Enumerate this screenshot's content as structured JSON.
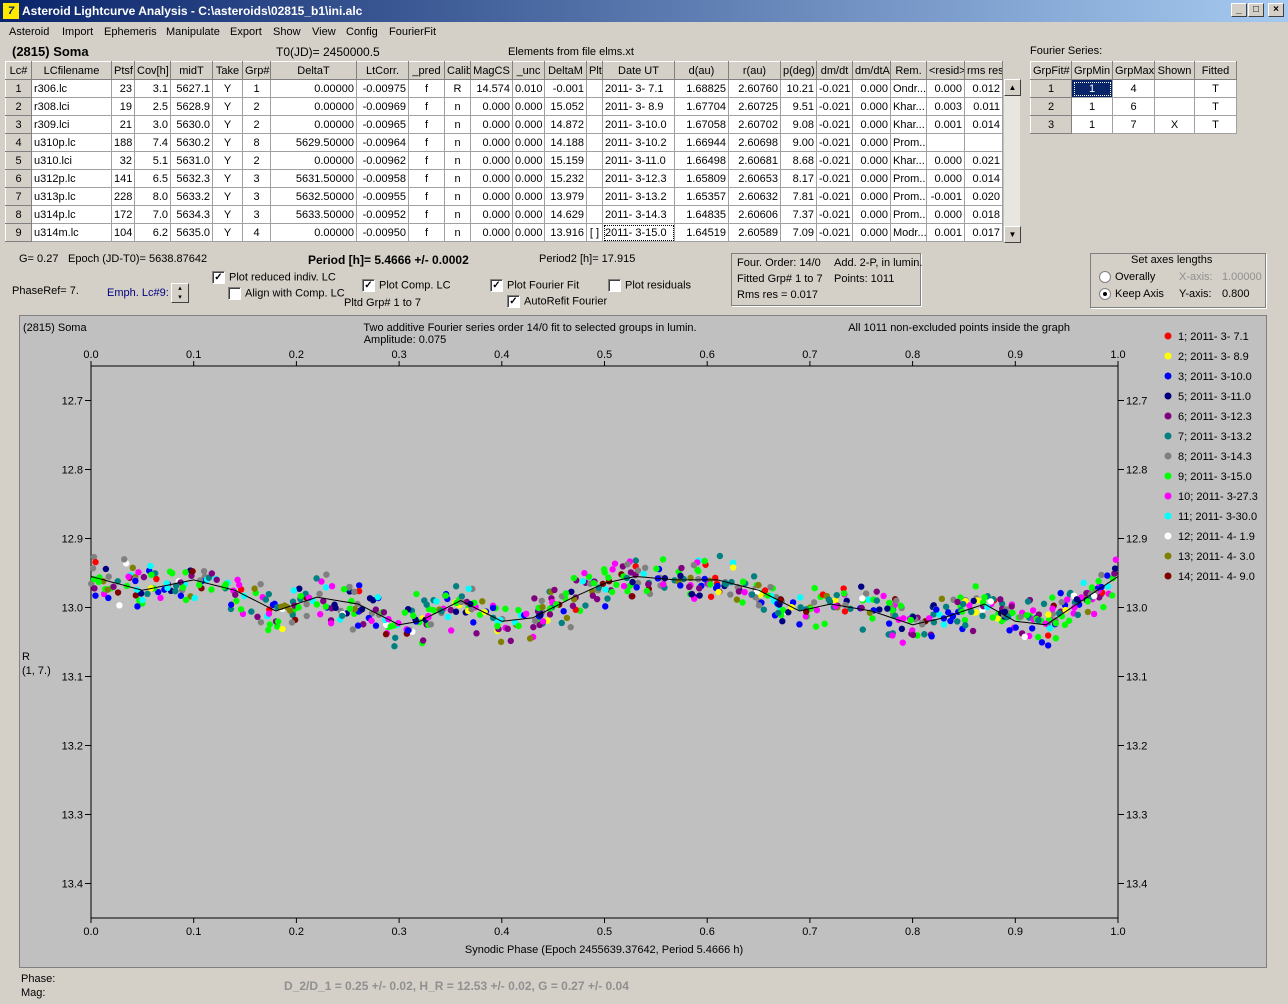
{
  "window": {
    "title": "Asteroid Lightcurve Analysis - C:\\asteroids\\02815_b1\\ini.alc",
    "icon": "app-icon",
    "min": "_",
    "max": "□",
    "close": "×"
  },
  "menu": [
    "Asteroid",
    "Import",
    "Ephemeris",
    "Manipulate",
    "Export",
    "Show",
    "View",
    "Config",
    "FourierFit"
  ],
  "asteroid_name": "(2815) Soma",
  "t0": "T0(JD)= 2450000.5",
  "elements_note": "Elements from file elms.xt",
  "lc_table": {
    "headers": [
      "Lc#",
      "LCfilename",
      "Ptsf",
      "Cov[h]",
      "midT",
      "Take",
      "Grp#",
      "DeltaT",
      "LtCorr.",
      "_pred",
      "Calib",
      "MagCS",
      "_unc",
      "DeltaM",
      "Plt",
      "Date UT",
      "d(au)",
      "r(au)",
      "p(deg)",
      "dm/dt",
      "dm/dtA",
      "Rem.",
      "<resid>",
      "rms res"
    ],
    "rows": [
      [
        "1",
        "r306.lc",
        "23",
        "3.1",
        "5627.1",
        "Y",
        "1",
        "0.00000",
        "-0.00975",
        "f",
        "R",
        "14.574",
        "0.010",
        "-0.001",
        "",
        "2011- 3- 7.1",
        "1.68825",
        "2.60760",
        "10.21",
        "-0.021",
        "0.000",
        "Ondr...",
        "0.000",
        "0.012"
      ],
      [
        "2",
        "r308.lci",
        "19",
        "2.5",
        "5628.9",
        "Y",
        "2",
        "0.00000",
        "-0.00969",
        "f",
        "n",
        "0.000",
        "0.000",
        "15.052",
        "",
        "2011- 3- 8.9",
        "1.67704",
        "2.60725",
        "9.51",
        "-0.021",
        "0.000",
        "Khar...",
        "0.003",
        "0.011"
      ],
      [
        "3",
        "r309.lci",
        "21",
        "3.0",
        "5630.0",
        "Y",
        "2",
        "0.00000",
        "-0.00965",
        "f",
        "n",
        "0.000",
        "0.000",
        "14.872",
        "",
        "2011- 3-10.0",
        "1.67058",
        "2.60702",
        "9.08",
        "-0.021",
        "0.000",
        "Khar...",
        "0.001",
        "0.014"
      ],
      [
        "4",
        "u310p.lc",
        "188",
        "7.4",
        "5630.2",
        "Y",
        "8",
        "5629.50000",
        "-0.00964",
        "f",
        "n",
        "0.000",
        "0.000",
        "14.188",
        "",
        "2011- 3-10.2",
        "1.66944",
        "2.60698",
        "9.00",
        "-0.021",
        "0.000",
        "Prom...",
        "",
        ""
      ],
      [
        "5",
        "u310.lci",
        "32",
        "5.1",
        "5631.0",
        "Y",
        "2",
        "0.00000",
        "-0.00962",
        "f",
        "n",
        "0.000",
        "0.000",
        "15.159",
        "",
        "2011- 3-11.0",
        "1.66498",
        "2.60681",
        "8.68",
        "-0.021",
        "0.000",
        "Khar...",
        "0.000",
        "0.021"
      ],
      [
        "6",
        "u312p.lc",
        "141",
        "6.5",
        "5632.3",
        "Y",
        "3",
        "5631.50000",
        "-0.00958",
        "f",
        "n",
        "0.000",
        "0.000",
        "15.232",
        "",
        "2011- 3-12.3",
        "1.65809",
        "2.60653",
        "8.17",
        "-0.021",
        "0.000",
        "Prom...",
        "0.000",
        "0.014"
      ],
      [
        "7",
        "u313p.lc",
        "228",
        "8.0",
        "5633.2",
        "Y",
        "3",
        "5632.50000",
        "-0.00955",
        "f",
        "n",
        "0.000",
        "0.000",
        "13.979",
        "",
        "2011- 3-13.2",
        "1.65357",
        "2.60632",
        "7.81",
        "-0.021",
        "0.000",
        "Prom...",
        "-0.001",
        "0.020"
      ],
      [
        "8",
        "u314p.lc",
        "172",
        "7.0",
        "5634.3",
        "Y",
        "3",
        "5633.50000",
        "-0.00952",
        "f",
        "n",
        "0.000",
        "0.000",
        "14.629",
        "",
        "2011- 3-14.3",
        "1.64835",
        "2.60606",
        "7.37",
        "-0.021",
        "0.000",
        "Prom...",
        "0.000",
        "0.018"
      ],
      [
        "9",
        "u314m.lc",
        "104",
        "6.2",
        "5635.0",
        "Y",
        "4",
        "0.00000",
        "-0.00950",
        "f",
        "n",
        "0.000",
        "0.000",
        "13.916",
        "[ ]",
        "2011- 3-15.0",
        "1.64519",
        "2.60589",
        "7.09",
        "-0.021",
        "0.000",
        "Modr...",
        "0.001",
        "0.017"
      ]
    ]
  },
  "fourier": {
    "label": "Fourier Series:",
    "headers": [
      "GrpFit#",
      "GrpMin",
      "GrpMax",
      "Shown",
      "Fitted"
    ],
    "rows": [
      [
        "1",
        "1",
        "4",
        "",
        "T"
      ],
      [
        "2",
        "1",
        "6",
        "",
        "T"
      ],
      [
        "3",
        "1",
        "7",
        "X",
        "T"
      ]
    ]
  },
  "info": {
    "g": "G= 0.27",
    "epoch": "Epoch (JD-T0)= 5638.87642",
    "period": "Period [h]= 5.4666 +/- 0.0002",
    "period2": "Period2 [h]= 17.915",
    "phaseref": "PhaseRef= 7.",
    "emph": "Emph. Lc#9:",
    "pltd": "Pltd Grp#  1   to   7"
  },
  "checks": {
    "reduced": {
      "label": "Plot reduced indiv. LC",
      "checked": true
    },
    "align": {
      "label": "Align with Comp. LC",
      "checked": false
    },
    "comp": {
      "label": "Plot Comp. LC",
      "checked": true
    },
    "fourier": {
      "label": "Plot Fourier Fit",
      "checked": true
    },
    "residuals": {
      "label": "Plot residuals",
      "checked": false
    },
    "autorefit": {
      "label": "AutoRefit Fourier",
      "checked": true
    }
  },
  "fitinfo": {
    "order": "Four. Order: 14/0",
    "add": "Add. 2-P, in lumin.",
    "fitted": "Fitted Grp# 1 to 7",
    "points": "Points: 1011",
    "rms": "Rms res     = 0.017"
  },
  "axes": {
    "title": "Set axes lengths",
    "overall": "Overally",
    "keep": "Keep Axis",
    "mode": "keep",
    "xaxis_label": "X-axis:",
    "xaxis_val": "1.00000",
    "yaxis_label": "Y-axis:",
    "yaxis_val": "0.800"
  },
  "plot": {
    "corner": "(2815) Soma",
    "caption": "Two additive Fourier series order 14/0 fit to selected groups in lumin.",
    "amplitude": "Amplitude: 0.075",
    "note": "All 1011 non-excluded points inside the graph",
    "xlabel": "Synodic Phase (Epoch 2455639.37642, Period 5.4666 h)",
    "ylabel1": "R",
    "ylabel2": "(1, 7.)"
  },
  "chart_data": {
    "type": "scatter",
    "title": "Two additive Fourier series order 14/0 fit to selected groups in lumin.",
    "xlabel": "Synodic Phase (Epoch 2455639.37642, Period 5.4666 h)",
    "ylabel": "R",
    "xlim": [
      0,
      1
    ],
    "ylim": [
      13.45,
      12.65
    ],
    "y_inverted": true,
    "xticks": [
      "0.0",
      "0.1",
      "0.2",
      "0.3",
      "0.4",
      "0.5",
      "0.6",
      "0.7",
      "0.8",
      "0.9",
      "1.0"
    ],
    "yticks": [
      "12.7",
      "12.8",
      "12.9",
      "13.0",
      "13.1",
      "13.2",
      "13.3",
      "13.4"
    ],
    "series": [
      {
        "name": "1; 2011- 3- 7.1",
        "color": "#ff0000"
      },
      {
        "name": "2; 2011- 3- 8.9",
        "color": "#ffff00"
      },
      {
        "name": "3; 2011- 3-10.0",
        "color": "#0000ff"
      },
      {
        "name": "5; 2011- 3-11.0",
        "color": "#000080"
      },
      {
        "name": "6; 2011- 3-12.3",
        "color": "#800080"
      },
      {
        "name": "7; 2011- 3-13.2",
        "color": "#008080"
      },
      {
        "name": "8; 2011- 3-14.3",
        "color": "#808080"
      },
      {
        "name": "9; 2011- 3-15.0",
        "color": "#00ff00"
      },
      {
        "name": "10; 2011- 3-27.3",
        "color": "#ff00ff"
      },
      {
        "name": "11; 2011- 3-30.0",
        "color": "#00ffff"
      },
      {
        "name": "12; 2011- 4- 1.9",
        "color": "#ffffff"
      },
      {
        "name": "13; 2011- 4- 3.0",
        "color": "#808000"
      },
      {
        "name": "14; 2011- 4- 9.0",
        "color": "#800000"
      }
    ],
    "fourier_fit": {
      "x": [
        0.0,
        0.05,
        0.1,
        0.14,
        0.18,
        0.22,
        0.26,
        0.3,
        0.32,
        0.36,
        0.4,
        0.43,
        0.47,
        0.5,
        0.53,
        0.57,
        0.61,
        0.65,
        0.69,
        0.72,
        0.76,
        0.8,
        0.83,
        0.87,
        0.9,
        0.93,
        0.96,
        1.0
      ],
      "y": [
        12.955,
        12.975,
        12.96,
        12.975,
        13.005,
        12.985,
        12.995,
        13.025,
        13.02,
        12.99,
        13.02,
        13.015,
        12.985,
        12.965,
        12.955,
        12.96,
        12.96,
        12.975,
        13.005,
        12.995,
        13.005,
        13.025,
        13.015,
        12.995,
        13.02,
        13.025,
        12.995,
        12.955
      ]
    }
  },
  "status": {
    "phase": "Phase:",
    "mag": "Mag:",
    "result": "D_2/D_1 = 0.25 +/- 0.02, H_R = 12.53 +/- 0.02, G = 0.27 +/- 0.04"
  }
}
